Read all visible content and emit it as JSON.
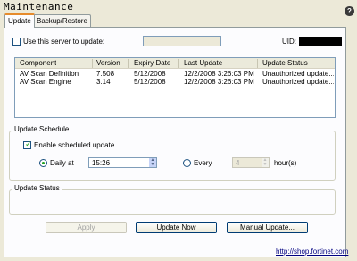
{
  "header": {
    "title": "Maintenance",
    "help_icon": "?"
  },
  "tabs": [
    {
      "label": "Update",
      "active": true
    },
    {
      "label": "Backup/Restore",
      "active": false
    }
  ],
  "server": {
    "checkbox_label": "Use this server to update:",
    "checked": false,
    "input_value": "",
    "uid_label": "UID:",
    "uid_value": ""
  },
  "table": {
    "columns": [
      "Component",
      "Version",
      "Expiry Date",
      "Last Update",
      "Update Status"
    ],
    "rows": [
      [
        "AV Scan Definition",
        "7.508",
        "5/12/2008",
        "12/2/2008 3:26:03 PM",
        "Unauthorized update..."
      ],
      [
        "AV Scan Engine",
        "3.14",
        "5/12/2008",
        "12/2/2008 3:26:03 PM",
        "Unauthorized update..."
      ]
    ]
  },
  "schedule": {
    "group_label": "Update Schedule",
    "enable_label": "Enable scheduled update",
    "enabled": true,
    "daily_label": "Daily at",
    "daily_selected": true,
    "daily_time": "15:26",
    "every_label": "Every",
    "every_value": "4",
    "hours_label": "hour(s)"
  },
  "status": {
    "group_label": "Update Status",
    "text": ""
  },
  "buttons": {
    "apply": "Apply",
    "update_now": "Update Now",
    "manual_update": "Manual Update..."
  },
  "footer": {
    "link": "http://shop.fortinet.com"
  },
  "colors": {
    "window_bg": "#ece9d8",
    "panel_bg": "#fcfcfe",
    "tab_accent": "#e68b2c",
    "check_mark": "#21a121"
  }
}
